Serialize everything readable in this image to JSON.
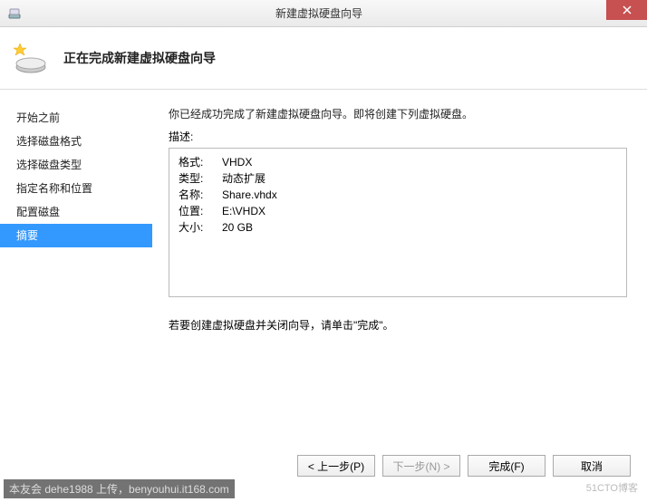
{
  "titlebar": {
    "title": "新建虚拟硬盘向导"
  },
  "header": {
    "title": "正在完成新建虚拟硬盘向导"
  },
  "sidebar": {
    "items": [
      {
        "label": "开始之前",
        "selected": false
      },
      {
        "label": "选择磁盘格式",
        "selected": false
      },
      {
        "label": "选择磁盘类型",
        "selected": false
      },
      {
        "label": "指定名称和位置",
        "selected": false
      },
      {
        "label": "配置磁盘",
        "selected": false
      },
      {
        "label": "摘要",
        "selected": true
      }
    ]
  },
  "main": {
    "intro": "你已经成功完成了新建虚拟硬盘向导。即将创建下列虚拟硬盘。",
    "desc_label": "描述:",
    "summary": [
      {
        "key": "格式:",
        "value": "VHDX"
      },
      {
        "key": "类型:",
        "value": "动态扩展"
      },
      {
        "key": "名称:",
        "value": "Share.vhdx"
      },
      {
        "key": "位置:",
        "value": "E:\\VHDX"
      },
      {
        "key": "大小:",
        "value": "20 GB"
      }
    ],
    "hint": "若要创建虚拟硬盘并关闭向导，请单击\"完成\"。"
  },
  "buttons": {
    "prev": "< 上一步(P)",
    "next": "下一步(N) >",
    "finish": "完成(F)",
    "cancel": "取消"
  },
  "footer": {
    "caption": "本友会 dehe1988 上传，benyouhui.it168.com",
    "watermark": "51CTO博客"
  }
}
